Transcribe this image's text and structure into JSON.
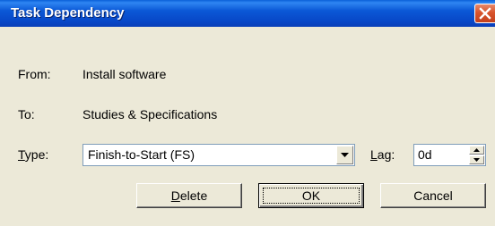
{
  "window": {
    "title": "Task Dependency",
    "close_icon": "close-icon",
    "colors": {
      "titlebar": "#0b58d6",
      "close_button": "#d8542c",
      "face": "#ece9d8"
    }
  },
  "from": {
    "label": "From:",
    "value": "Install software"
  },
  "to": {
    "label": "To:",
    "value": "Studies & Specifications"
  },
  "type": {
    "label_accel": "T",
    "label_rest": "ype:",
    "selected": "Finish-to-Start (FS)"
  },
  "lag": {
    "label_accel": "L",
    "label_rest": "ag:",
    "value": "0d"
  },
  "buttons": {
    "delete_accel": "D",
    "delete_rest": "elete",
    "ok": "OK",
    "cancel": "Cancel"
  }
}
